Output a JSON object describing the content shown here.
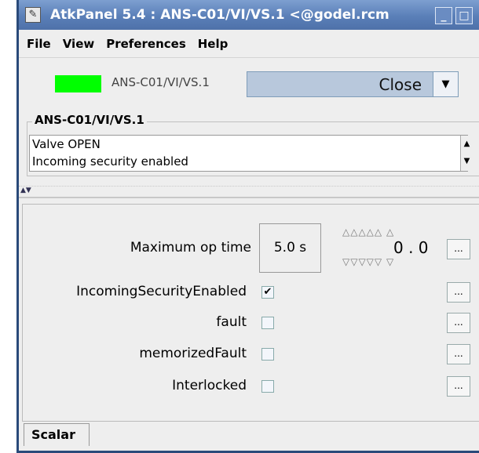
{
  "window": {
    "app_icon": "app-window-icon",
    "title": "AtkPanel 5.4  : ANS-C01/VI/VS.1 <@godel.rcm",
    "minimize": "_",
    "maximize": "□",
    "close": "x"
  },
  "menu": [
    "File",
    "View",
    "Preferences",
    "Help"
  ],
  "device": {
    "name": "ANS-C01/VI/VS.1",
    "state_color": "#00ff00",
    "command": "Close",
    "combo_arrow": "▼"
  },
  "status": {
    "title": "ANS-C01/VI/VS.1",
    "lines": [
      "Valve OPEN",
      "Incoming security enabled"
    ],
    "scroll_up": "▲",
    "scroll_down": "▼"
  },
  "splitter": {
    "arrows": "▲▼"
  },
  "attributes": {
    "max_op_time": {
      "label": "Maximum op time",
      "value": "5.0 s",
      "spinner_up": "△△△△△  △",
      "spinner_value": "0 . 0",
      "spinner_down": "▽▽▽▽▽  ▽",
      "more": "..."
    },
    "incoming_security": {
      "label": "IncomingSecurityEnabled",
      "checked": "✔",
      "more": "..."
    },
    "fault": {
      "label": "fault",
      "checked": "",
      "more": "..."
    },
    "memorized_fault": {
      "label": "memorizedFault",
      "checked": "",
      "more": "..."
    },
    "interlocked": {
      "label": "Interlocked",
      "checked": "",
      "more": "..."
    }
  },
  "tabs": [
    {
      "label": "Scalar"
    }
  ]
}
